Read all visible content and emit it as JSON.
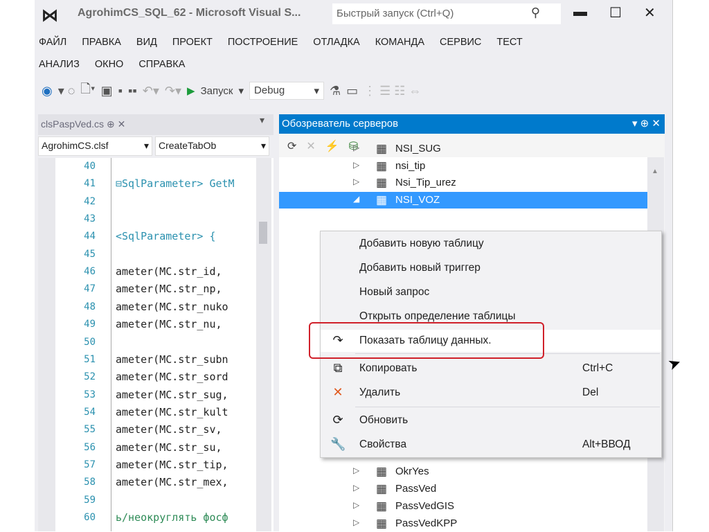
{
  "window": {
    "title": "AgrohimCS_SQL_62 - Microsoft Visual S...",
    "quick_launch_placeholder": "Быстрый запуск (Ctrl+Q)",
    "minimize": "▬",
    "maximize": "☐",
    "close": "✕"
  },
  "menu": {
    "row1": [
      "ФАЙЛ",
      "ПРАВКА",
      "ВИД",
      "ПРОЕКТ",
      "ПОСТРОЕНИЕ",
      "ОТЛАДКА",
      "КОМАНДА",
      "СЕРВИС",
      "ТЕСТ"
    ],
    "row2": [
      "АНАЛИЗ",
      "ОКНО",
      "СПРАВКА"
    ]
  },
  "toolbar": {
    "run_label": "Запуск",
    "config": "Debug"
  },
  "editor": {
    "tab": "clsPaspVed.cs",
    "tab_pin": "⊕",
    "tab_close": "✕",
    "nav_class": "AgrohimCS.clsf",
    "nav_member": "CreateTabOb",
    "lines": [
      {
        "n": "40",
        "c": ""
      },
      {
        "n": "41",
        "c": "⊟SqlParameter> GetM"
      },
      {
        "n": "42",
        "c": ""
      },
      {
        "n": "43",
        "c": ""
      },
      {
        "n": "44",
        "c": "<SqlParameter> {"
      },
      {
        "n": "45",
        "c": ""
      },
      {
        "n": "46",
        "c": "ameter(MC.str_id,"
      },
      {
        "n": "47",
        "c": "ameter(MC.str_np,"
      },
      {
        "n": "48",
        "c": "ameter(MC.str_nuko"
      },
      {
        "n": "49",
        "c": "ameter(MC.str_nu,"
      },
      {
        "n": "50",
        "c": ""
      },
      {
        "n": "51",
        "c": "ameter(MC.str_subn"
      },
      {
        "n": "52",
        "c": "ameter(MC.str_sord"
      },
      {
        "n": "53",
        "c": "ameter(MC.str_sug,"
      },
      {
        "n": "54",
        "c": "ameter(MC.str_kult"
      },
      {
        "n": "55",
        "c": "ameter(MC.str_sv,"
      },
      {
        "n": "56",
        "c": "ameter(MC.str_su,"
      },
      {
        "n": "57",
        "c": "ameter(MC.str_tip,"
      },
      {
        "n": "58",
        "c": "ameter(MC.str_mex,"
      },
      {
        "n": "59",
        "c": ""
      },
      {
        "n": "60",
        "c": "ь/неокруглять фосф"
      }
    ]
  },
  "server_explorer": {
    "title": "Обозреватель серверов",
    "header_buttons": "▾ ⊕ ✕",
    "tree_top": [
      "NSI_SUG",
      "nsi_tip",
      "Nsi_Tip_urez",
      "NSI_VOZ"
    ],
    "tree_bottom": [
      "OkrYes",
      "PassVed",
      "PassVedGIS",
      "PassVedKPP"
    ]
  },
  "context_menu": [
    {
      "label": "Добавить новую таблицу",
      "shortcut": "",
      "icon": ""
    },
    {
      "label": "Добавить новый триггер",
      "shortcut": "",
      "icon": ""
    },
    {
      "label": "Новый запрос",
      "shortcut": "",
      "icon": ""
    },
    {
      "label": "Открыть определение таблицы",
      "shortcut": "",
      "icon": ""
    },
    {
      "label": "Показать таблицу данных.",
      "shortcut": "",
      "icon": "↷"
    },
    {
      "label": "Копировать",
      "shortcut": "Ctrl+C",
      "icon": "⧉"
    },
    {
      "label": "Удалить",
      "shortcut": "Del",
      "icon": "✕"
    },
    {
      "label": "Обновить",
      "shortcut": "",
      "icon": "⟳"
    },
    {
      "label": "Свойства",
      "shortcut": "Alt+ВВОД",
      "icon": "🔧"
    }
  ],
  "colors": {
    "accent": "#007acc",
    "selection": "#3399ff",
    "highlight_box": "#d0202a",
    "delete_icon": "#e05a1e"
  }
}
